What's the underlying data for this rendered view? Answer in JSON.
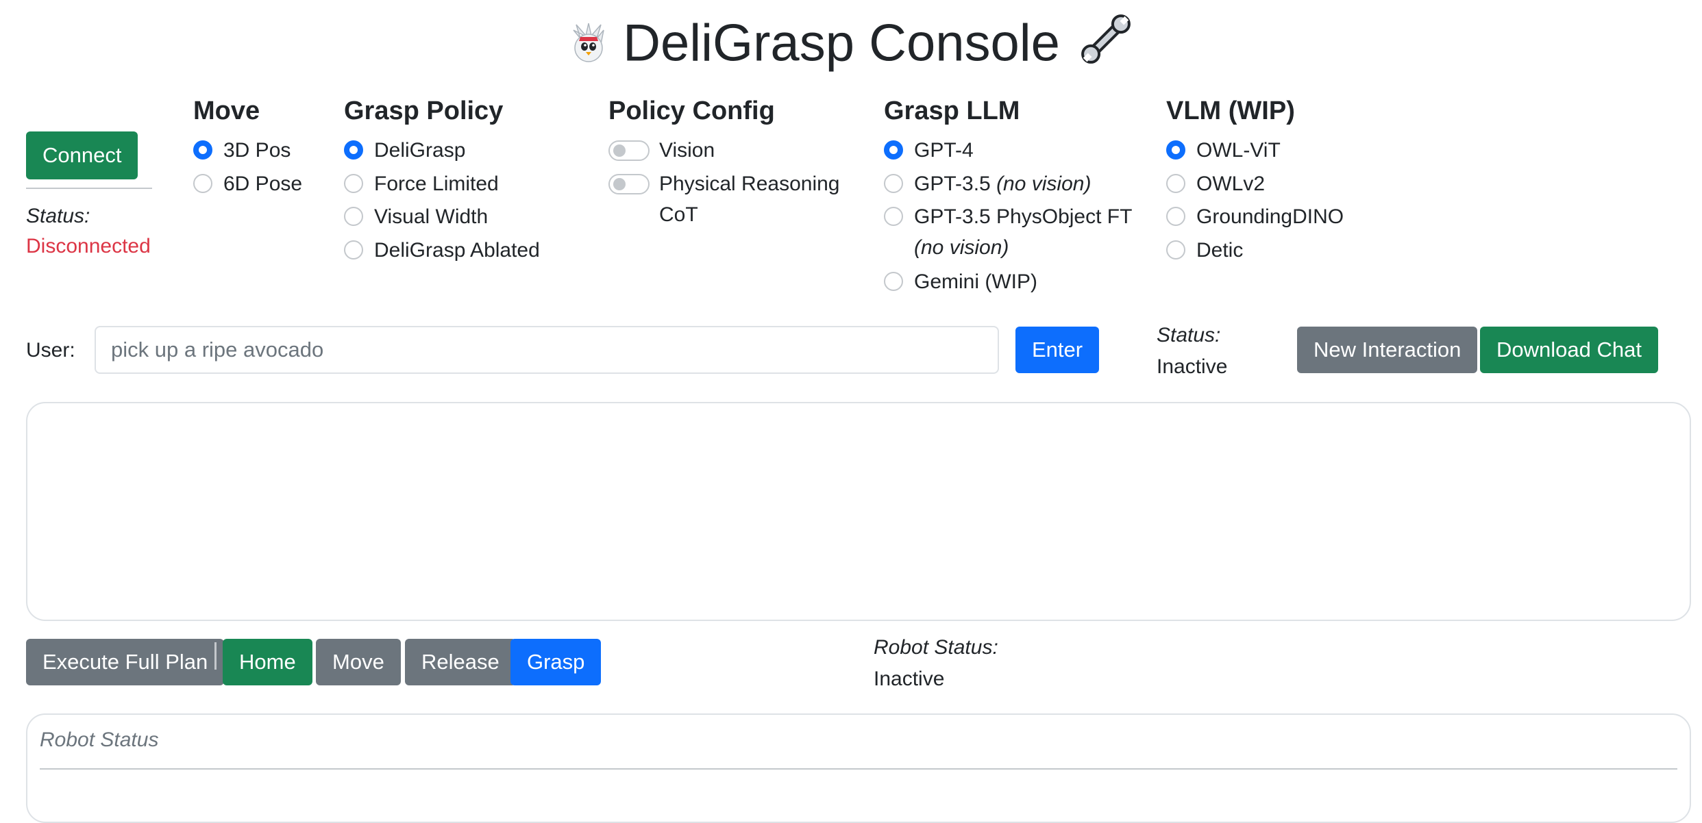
{
  "header": {
    "title": "DeliGrasp Console",
    "logo_icon": "penguin-mascot-icon",
    "wrench_icon": "wrench-icon"
  },
  "connection": {
    "button": "Connect",
    "status_label": "Status:",
    "status_value": "Disconnected",
    "status_color": "#dc3545"
  },
  "move": {
    "title": "Move",
    "options": [
      "3D Pos",
      "6D Pose"
    ],
    "selected": "3D Pos"
  },
  "grasp_policy": {
    "title": "Grasp Policy",
    "options": [
      "DeliGrasp",
      "Force Limited",
      "Visual Width",
      "DeliGrasp Ablated"
    ],
    "selected": "DeliGrasp"
  },
  "policy_config": {
    "title": "Policy Config",
    "toggles": [
      {
        "label": "Vision",
        "on": false
      },
      {
        "label_line1": "Physical Reasoning",
        "label_line2": "CoT",
        "on": false
      }
    ]
  },
  "grasp_llm": {
    "title": "Grasp LLM",
    "options": [
      {
        "label": "GPT-4"
      },
      {
        "label": "GPT-3.5",
        "note": "(no vision)"
      },
      {
        "label": "GPT-3.5 PhysObject FT",
        "note": "(no vision)"
      },
      {
        "label": "Gemini (WIP)"
      }
    ],
    "selected": "GPT-4"
  },
  "vlm": {
    "title": "VLM (WIP)",
    "options": [
      "OWL-ViT",
      "OWLv2",
      "GroundingDINO",
      "Detic"
    ],
    "selected": "OWL-ViT"
  },
  "chat": {
    "user_label": "User:",
    "placeholder": "pick up a ripe avocado",
    "enter_button": "Enter",
    "status_label": "Status:",
    "status_value": "Inactive",
    "new_interaction_button": "New Interaction",
    "download_button": "Download Chat"
  },
  "robot_controls": {
    "buttons": [
      "Execute Full Plan",
      "Home",
      "Move",
      "Release",
      "Grasp"
    ],
    "status_label": "Robot Status:",
    "status_value": "Inactive"
  },
  "robot_status_panel": {
    "header": "Robot Status"
  },
  "colors": {
    "primary": "#0d6efd",
    "success": "#198754",
    "secondary": "#6c757d",
    "danger": "#dc3545"
  }
}
